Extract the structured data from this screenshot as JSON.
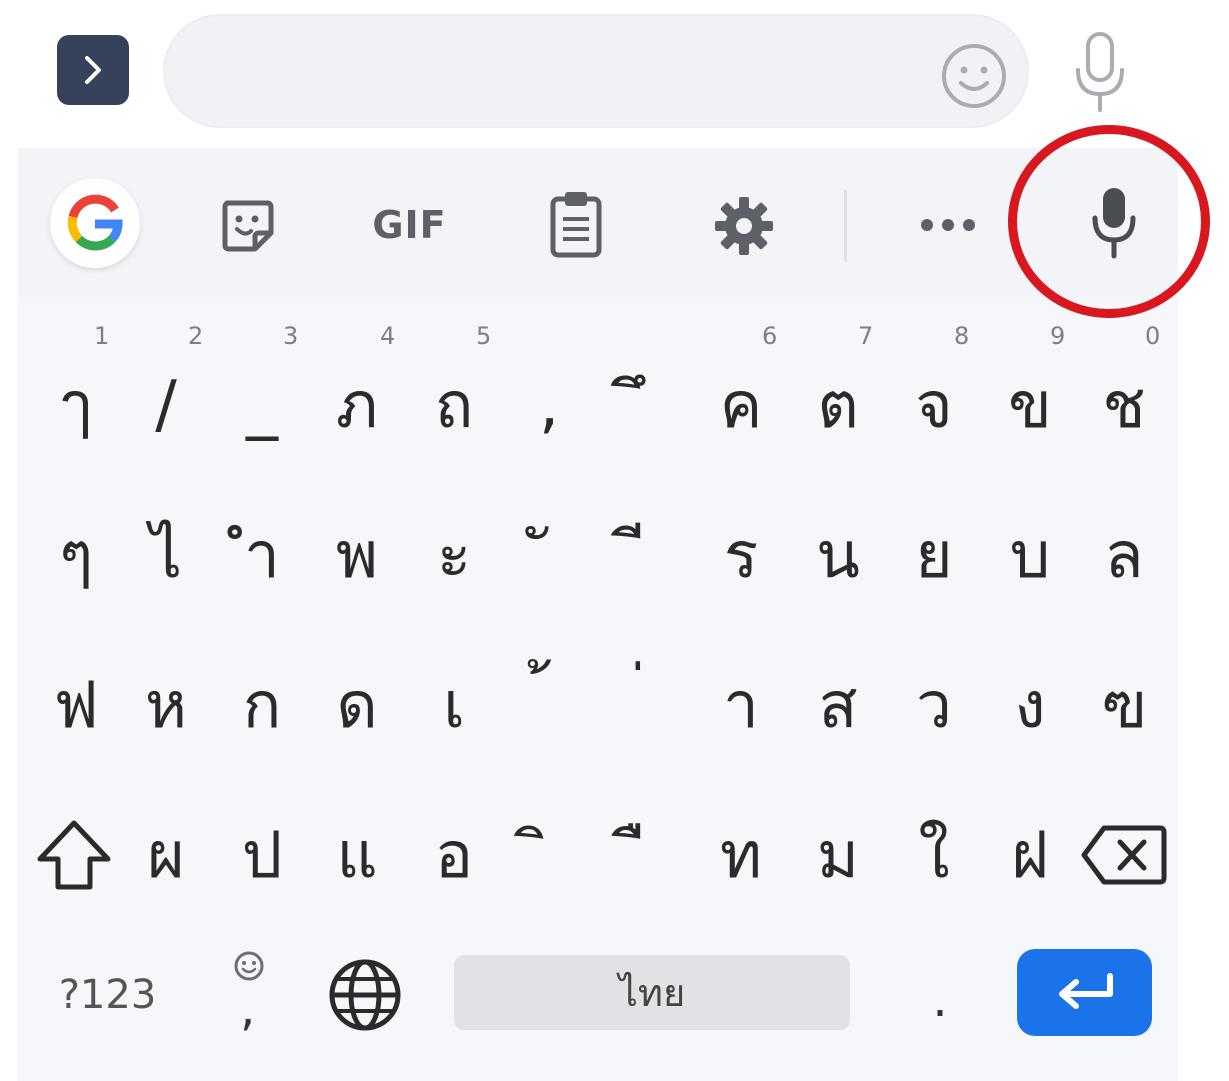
{
  "input_bar": {
    "text_value": "",
    "expand_icon": "chevron-right-icon",
    "emoji_icon": "smiley-icon",
    "mic_icon": "microphone-icon"
  },
  "toolbar": {
    "google_icon": "google-g-icon",
    "sticker_icon": "sticker-icon",
    "gif_label": "GIF",
    "clipboard_icon": "clipboard-icon",
    "settings_icon": "gear-icon",
    "more_icon": "more-horizontal-icon",
    "voice_icon": "microphone-icon",
    "highlight_color": "#d9171e"
  },
  "keys": {
    "row1": [
      {
        "char": "ๅ",
        "hint": "1"
      },
      {
        "char": "/",
        "hint": "2"
      },
      {
        "char": "_",
        "hint": "3"
      },
      {
        "char": "ภ",
        "hint": "4"
      },
      {
        "char": "ถ",
        "hint": "5"
      },
      {
        "char": ",",
        "hint": ""
      },
      {
        "char": "ึ",
        "hint": ""
      },
      {
        "char": "ค",
        "hint": "6"
      },
      {
        "char": "ต",
        "hint": "7"
      },
      {
        "char": "จ",
        "hint": "8"
      },
      {
        "char": "ข",
        "hint": "9"
      },
      {
        "char": "ช",
        "hint": "0"
      }
    ],
    "row2": [
      "ๆ",
      "ไ",
      "ำ",
      "พ",
      "ะ",
      "ั",
      "ี",
      "ร",
      "น",
      "ย",
      "บ",
      "ล"
    ],
    "row3": [
      "ฟ",
      "ห",
      "ก",
      "ด",
      "เ",
      "้",
      "่",
      "า",
      "ส",
      "ว",
      "ง",
      "ฃ"
    ],
    "row4": [
      "ผ",
      "ป",
      "แ",
      "อ",
      "ิ",
      "ื",
      "ท",
      "ม",
      "ใ",
      "ฝ"
    ],
    "shift_icon": "shift-arrow-icon",
    "backspace_icon": "backspace-icon"
  },
  "bottom_row": {
    "symbols_label": "?123",
    "comma_label": ",",
    "globe_icon": "globe-icon",
    "space_label": "ไทย",
    "period_label": ".",
    "enter_icon": "enter-icon",
    "enter_color": "#1a73e8"
  }
}
